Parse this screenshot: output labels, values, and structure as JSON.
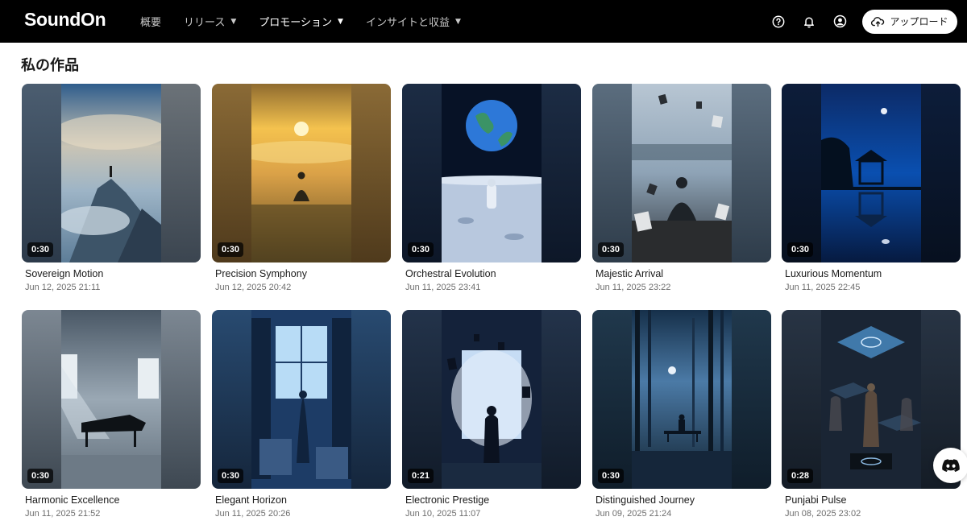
{
  "brand": {
    "logo": "SoundOn"
  },
  "nav": {
    "items": [
      {
        "label": "概要",
        "has_caret": false,
        "active": false
      },
      {
        "label": "リリース",
        "has_caret": true,
        "active": false
      },
      {
        "label": "プロモーション",
        "has_caret": true,
        "active": true
      },
      {
        "label": "インサイトと収益",
        "has_caret": true,
        "active": false
      }
    ],
    "caret": "▼"
  },
  "header_actions": {
    "icons": [
      "help-icon",
      "bell-icon",
      "account-icon"
    ],
    "upload_label": "アップロード"
  },
  "section": {
    "title": "私の作品"
  },
  "works": [
    {
      "title": "Sovereign Motion",
      "date": "Jun 12, 2025 21:11",
      "duration": "0:30"
    },
    {
      "title": "Precision Symphony",
      "date": "Jun 12, 2025 20:42",
      "duration": "0:30"
    },
    {
      "title": "Orchestral Evolution",
      "date": "Jun 11, 2025 23:41",
      "duration": "0:30"
    },
    {
      "title": "Majestic Arrival",
      "date": "Jun 11, 2025 23:22",
      "duration": "0:30"
    },
    {
      "title": "Luxurious Momentum",
      "date": "Jun 11, 2025 22:45",
      "duration": "0:30"
    },
    {
      "title": "Harmonic Excellence",
      "date": "Jun 11, 2025 21:52",
      "duration": "0:30"
    },
    {
      "title": "Elegant Horizon",
      "date": "Jun 11, 2025 20:26",
      "duration": "0:30"
    },
    {
      "title": "Electronic Prestige",
      "date": "Jun 10, 2025 11:07",
      "duration": "0:21"
    },
    {
      "title": "Distinguished Journey",
      "date": "Jun 09, 2025 21:24",
      "duration": "0:30"
    },
    {
      "title": "Punjabi Pulse",
      "date": "Jun 08, 2025 23:02",
      "duration": "0:28"
    }
  ],
  "floating": {
    "icon": "discord-icon"
  },
  "colors": {
    "topbar": "#000000",
    "background": "#ffffff",
    "text": "#1a1a1a",
    "subtext": "#6d6d6d"
  }
}
